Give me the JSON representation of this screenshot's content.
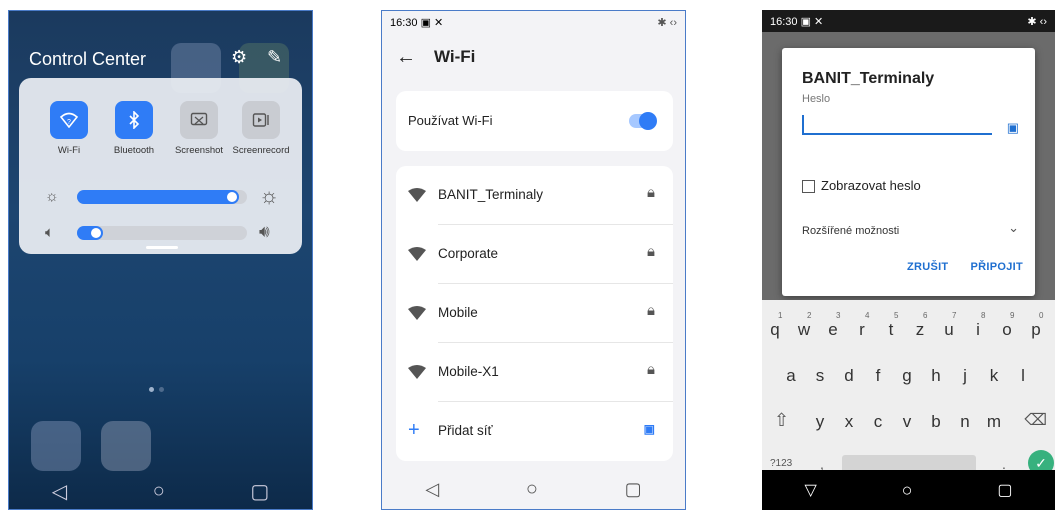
{
  "panel1": {
    "title": "Control Center",
    "header_icons": [
      "gear-icon",
      "pencil-icon"
    ],
    "tiles": [
      {
        "label": "Wi-Fi",
        "icon": "wifi-icon",
        "active": true
      },
      {
        "label": "Bluetooth",
        "icon": "bluetooth-icon",
        "active": true
      },
      {
        "label": "Screenshot",
        "icon": "screenshot-icon",
        "active": false
      },
      {
        "label": "Screenrecord",
        "icon": "screenrecord-icon",
        "active": false
      }
    ],
    "brightness_level": 0.95,
    "volume_level": 0.15,
    "accent": "#2f7cf6"
  },
  "panel2": {
    "status_time": "16:30",
    "title": "Wi-Fi",
    "use_wifi_label": "Používat Wi-Fi",
    "use_wifi_on": true,
    "networks": [
      {
        "name": "BANIT_Terminaly",
        "locked": true
      },
      {
        "name": "Corporate",
        "locked": true
      },
      {
        "name": "Mobile",
        "locked": true
      },
      {
        "name": "Mobile-X1",
        "locked": true
      }
    ],
    "add_network_label": "Přidat síť"
  },
  "panel3": {
    "status_time": "16:30",
    "dialog_title": "BANIT_Terminaly",
    "password_label": "Heslo",
    "password_value": "",
    "show_password_label": "Zobrazovat heslo",
    "advanced_label": "Rozšířené možnosti",
    "cancel_label": "ZRUŠIT",
    "connect_label": "PŘIPOJIT",
    "keyboard": {
      "row1": [
        "q",
        "w",
        "e",
        "r",
        "t",
        "z",
        "u",
        "i",
        "o",
        "p"
      ],
      "row1_nums": [
        "1",
        "2",
        "3",
        "4",
        "5",
        "6",
        "7",
        "8",
        "9",
        "0"
      ],
      "row2": [
        "a",
        "s",
        "d",
        "f",
        "g",
        "h",
        "j",
        "k",
        "l"
      ],
      "row3": [
        "y",
        "x",
        "c",
        "v",
        "b",
        "n",
        "m"
      ],
      "symbols_label": "?123",
      "comma": ",",
      "period": "."
    }
  }
}
